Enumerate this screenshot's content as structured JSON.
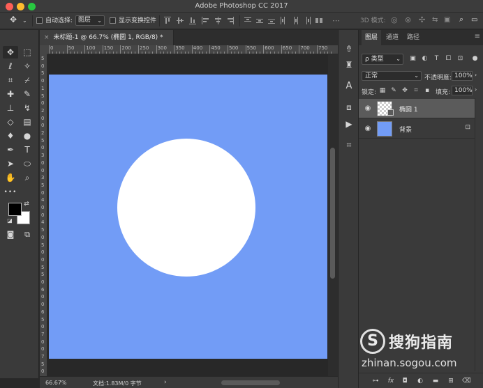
{
  "window": {
    "title": "Adobe Photoshop CC 2017"
  },
  "options_bar": {
    "auto_select_label": "自动选择:",
    "auto_select_target": "图层",
    "show_transform_label": "显示变换控件",
    "mode_3d_label": "3D 模式:"
  },
  "document": {
    "tab_title": "未标题-1 @ 66.7% (椭圆 1, RGB/8) *",
    "canvas_color": "#729cf6",
    "circle_color": "#ffffff"
  },
  "ruler": {
    "top_ticks": [
      "0",
      "50",
      "100",
      "150",
      "200",
      "250",
      "300",
      "350",
      "400",
      "450",
      "500",
      "550",
      "600",
      "650",
      "700",
      "750"
    ],
    "left_ticks": [
      "5",
      "0",
      "5",
      "0",
      "1",
      "5",
      "0",
      "2",
      "0",
      "0",
      "2",
      "5",
      "0",
      "3",
      "0",
      "0",
      "3",
      "5",
      "0",
      "4",
      "0",
      "0",
      "4",
      "5",
      "0",
      "5",
      "0",
      "0",
      "5",
      "5",
      "0",
      "6",
      "0",
      "0",
      "6",
      "5",
      "0",
      "7",
      "0",
      "0",
      "7",
      "5",
      "0"
    ]
  },
  "status_bar": {
    "zoom": "66.67%",
    "doc_info": "文档:1.83M/0 字节",
    "arrow": "›"
  },
  "toolbar": {
    "foreground_color": "#000000",
    "background_color": "#ffffff",
    "more_label": "•••"
  },
  "layers_panel": {
    "tabs": [
      "图层",
      "通道",
      "路径"
    ],
    "active_tab": "图层",
    "filter_label": "ρ 类型",
    "blend_mode": "正常",
    "opacity_label": "不透明度:",
    "opacity_value": "100%",
    "lock_label": "锁定:",
    "fill_label": "填充:",
    "fill_value": "100%",
    "layers": [
      {
        "name": "椭圆 1",
        "selected": true,
        "thumb": "transparent",
        "visible": true
      },
      {
        "name": "背景",
        "selected": false,
        "thumb": "#729cf6",
        "visible": true,
        "locked": true
      }
    ],
    "bottom_icons": [
      "link-icon",
      "fx-icon",
      "mask-icon",
      "adjustment-icon",
      "folder-icon",
      "new-layer-icon",
      "trash-icon"
    ]
  },
  "watermark": {
    "logo": "S",
    "text": "搜狗指南",
    "url": "zhinan.sogou.com"
  }
}
